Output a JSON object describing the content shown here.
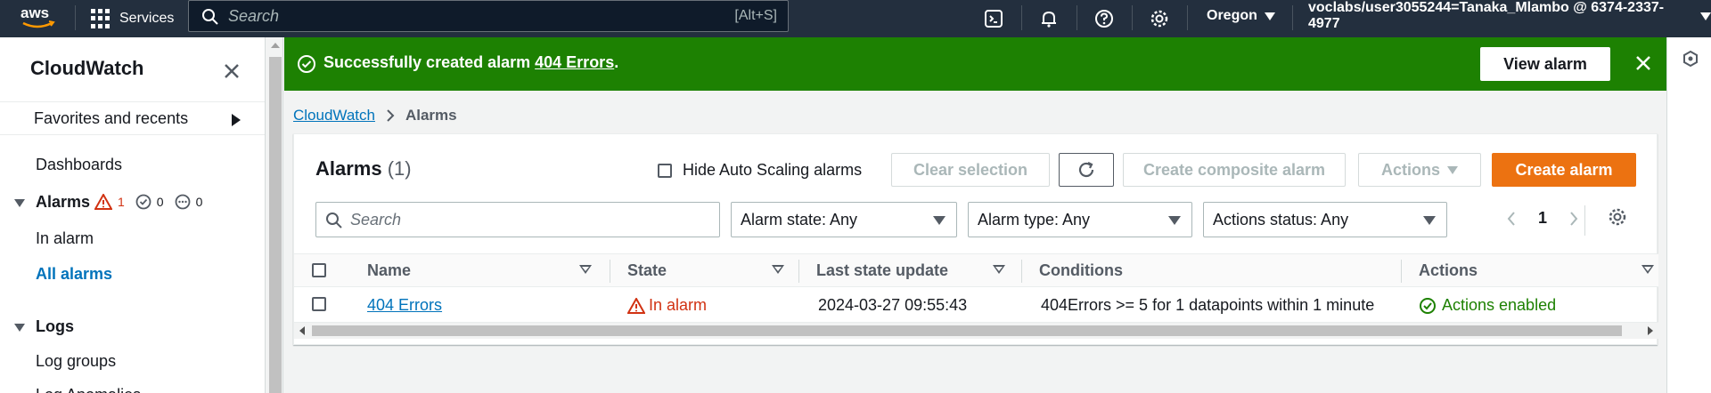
{
  "topbar": {
    "logo_text": "aws",
    "services_label": "Services",
    "search_placeholder": "Search",
    "search_shortcut": "[Alt+S]",
    "region": "Oregon",
    "account": "voclabs/user3055244=Tanaka_Mlambo @ 6374-2337-4977"
  },
  "sidenav": {
    "title": "CloudWatch",
    "favorites_label": "Favorites and recents",
    "dashboards_label": "Dashboards",
    "alarms_label": "Alarms",
    "alarm_count_in_alarm": "1",
    "alarm_count_ok": "0",
    "alarm_count_insufficient": "0",
    "in_alarm_label": "In alarm",
    "all_alarms_label": "All alarms",
    "logs_label": "Logs",
    "log_groups_label": "Log groups",
    "log_anomalies_label": "Log Anomalies"
  },
  "flash": {
    "message_prefix": "Successfully created alarm ",
    "alarm_name": "404 Errors",
    "message_suffix": ".",
    "view_button": "View alarm"
  },
  "breadcrumb": {
    "root": "CloudWatch",
    "current": "Alarms"
  },
  "panel": {
    "title": "Alarms",
    "count": "(1)",
    "hide_autoscaling_label": "Hide Auto Scaling alarms",
    "clear_selection_label": "Clear selection",
    "create_composite_label": "Create composite alarm",
    "actions_label": "Actions",
    "create_alarm_label": "Create alarm",
    "search_placeholder": "Search",
    "filter_state": "Alarm state: Any",
    "filter_type": "Alarm type: Any",
    "filter_actions": "Actions status: Any",
    "page_number": "1"
  },
  "table": {
    "headers": {
      "name": "Name",
      "state": "State",
      "last_update": "Last state update",
      "conditions": "Conditions",
      "actions": "Actions"
    },
    "rows": [
      {
        "name": "404 Errors",
        "state": "In alarm",
        "last_update": "2024-03-27 09:55:43",
        "conditions": "404Errors >= 5 for 1 datapoints within 1 minute",
        "actions": "Actions enabled"
      }
    ]
  },
  "colors": {
    "topbar_bg": "#232f3e",
    "success_green": "#1d8102",
    "alarm_red": "#d13212",
    "link_blue": "#0073bb",
    "primary_orange": "#ec7211"
  }
}
